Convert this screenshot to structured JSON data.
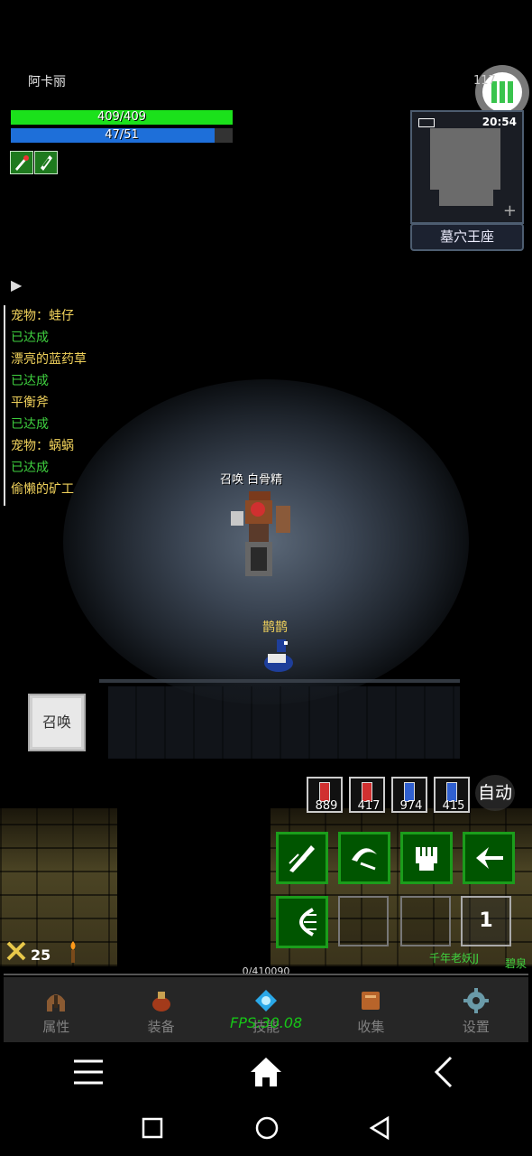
{
  "player": {
    "name": "阿卡丽",
    "hp_text": "409/409",
    "mp_text": "47/51"
  },
  "corner_indicator": "117",
  "minimap": {
    "clock": "20:54",
    "map_name": "墓穴王座",
    "expand": "+"
  },
  "quest_toggle": "▶",
  "quests": [
    {
      "name": "宠物：蛙仔",
      "status": "已达成"
    },
    {
      "name": "漂亮的蓝药草",
      "status": "已达成"
    },
    {
      "name": "平衡斧",
      "status": "已达成"
    },
    {
      "name": "宠物：蜗蜗",
      "status": "已达成"
    },
    {
      "name": "偷懒的矿工",
      "status": ""
    }
  ],
  "player_label": "召唤 白骨精",
  "pet_label": "鹊鹊",
  "summon_label": "召唤",
  "potions": [
    {
      "count": "889",
      "color": "#d03030"
    },
    {
      "count": "417",
      "color": "#d03030"
    },
    {
      "count": "974",
      "color": "#3060d0"
    },
    {
      "count": "415",
      "color": "#3060d0"
    }
  ],
  "auto_label": "自动",
  "skill_icons": [
    "slash-skill-icon",
    "crescent-skill-icon",
    "fist-skill-icon",
    "arrow-skill-icon",
    "wave-skill-icon"
  ],
  "skill_extra_count": "1",
  "level": "25",
  "nearby_players": [
    "千年老妖JJ",
    "碧泉"
  ],
  "exp_text": "0/410090",
  "fps": "FPS:30.08",
  "game_nav": [
    {
      "label": "属性",
      "icon": "helmet-icon"
    },
    {
      "label": "装备",
      "icon": "bag-icon"
    },
    {
      "label": "技能",
      "icon": "gem-icon"
    },
    {
      "label": "收集",
      "icon": "book-icon"
    },
    {
      "label": "设置",
      "icon": "gear-icon"
    }
  ],
  "colors": {
    "hp": "#1be11b",
    "mp": "#1e6fd9",
    "quest_name": "#f2d35c",
    "quest_done": "#3fd13f",
    "skill_border": "#1b9d1b"
  }
}
